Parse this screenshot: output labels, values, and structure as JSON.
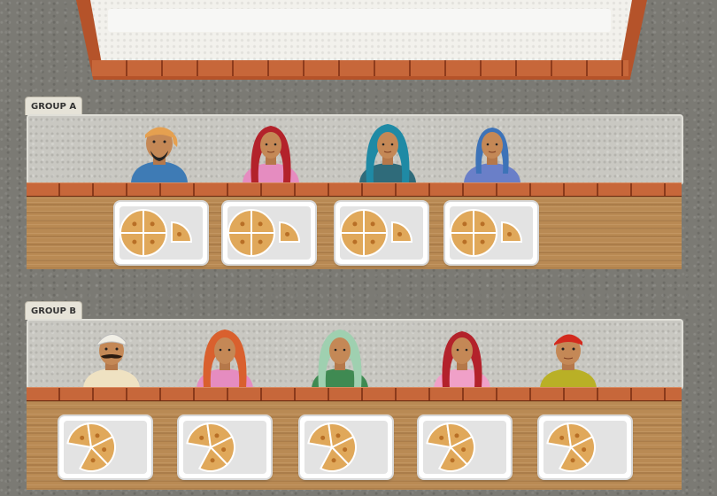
{
  "groups": [
    {
      "label": "GROUP A",
      "people": [
        "man-turban-beard",
        "woman-red-sari",
        "woman-teal-sari",
        "woman-blue-headscarf"
      ],
      "trays": [
        {
          "whole_pieces": 4,
          "whole_of": 4,
          "partial_pieces": 1,
          "partial_of": 4
        },
        {
          "whole_pieces": 4,
          "whole_of": 4,
          "partial_pieces": 1,
          "partial_of": 4
        },
        {
          "whole_pieces": 4,
          "whole_of": 4,
          "partial_pieces": 1,
          "partial_of": 4
        },
        {
          "whole_pieces": 4,
          "whole_of": 4,
          "partial_pieces": 1,
          "partial_of": 4
        }
      ]
    },
    {
      "label": "GROUP B",
      "people": [
        "man-white-turban-mustache",
        "woman-orange-sari",
        "woman-green-sari",
        "woman-red-pink-sari",
        "man-red-turban"
      ],
      "trays": [
        {
          "pieces": 4,
          "of": 5
        },
        {
          "pieces": 4,
          "of": 5
        },
        {
          "pieces": 4,
          "of": 5
        },
        {
          "pieces": 4,
          "of": 5
        },
        {
          "pieces": 4,
          "of": 5
        }
      ]
    }
  ],
  "colors": {
    "brick": "#c7673a",
    "wood": "#b98a54",
    "wall": "#c9c8c2",
    "roti": "#e0a85a",
    "roti_dark": "#b86f26"
  }
}
